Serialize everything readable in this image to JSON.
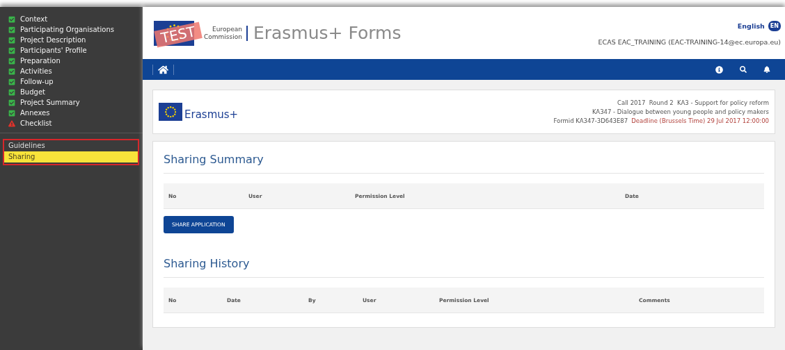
{
  "sidebar": {
    "items": [
      {
        "label": "Context",
        "kind": "done"
      },
      {
        "label": "Participating Organisations",
        "kind": "done"
      },
      {
        "label": "Project Description",
        "kind": "done"
      },
      {
        "label": "Participants' Profile",
        "kind": "done"
      },
      {
        "label": "Preparation",
        "kind": "done"
      },
      {
        "label": "Activities",
        "kind": "done"
      },
      {
        "label": "Follow-up",
        "kind": "done"
      },
      {
        "label": "Budget",
        "kind": "done"
      },
      {
        "label": "Project Summary",
        "kind": "done"
      },
      {
        "label": "Annexes",
        "kind": "done"
      },
      {
        "label": "Checklist",
        "kind": "warning"
      }
    ],
    "links": [
      {
        "label": "Guidelines",
        "selected": false
      },
      {
        "label": "Sharing",
        "selected": true
      }
    ]
  },
  "header": {
    "stamp": "TEST",
    "org_line_1": "European",
    "org_line_2": "Commission",
    "title": "Erasmus+ Forms",
    "language": "English",
    "language_code": "EN",
    "user": "ECAS EAC_TRAINING (EAC-TRAINING-14@ec.europa.eu)"
  },
  "info": {
    "brand": "Erasmus+",
    "call": "Call 2017  Round 2  KA3 - Support for policy reform",
    "action": "KA347 - Dialogue between young people and policy makers",
    "form_id": "Formid KA347-3D643E87",
    "deadline": "Deadline (Brussels Time) 29 Jul 2017 12:00:00"
  },
  "summary": {
    "title": "Sharing Summary",
    "columns": [
      "No",
      "User",
      "Permission Level",
      "Date"
    ],
    "button": "SHARE APPLICATION"
  },
  "history": {
    "title": "Sharing History",
    "columns": [
      "No",
      "Date",
      "By",
      "User",
      "Permission Level",
      "Comments"
    ]
  }
}
